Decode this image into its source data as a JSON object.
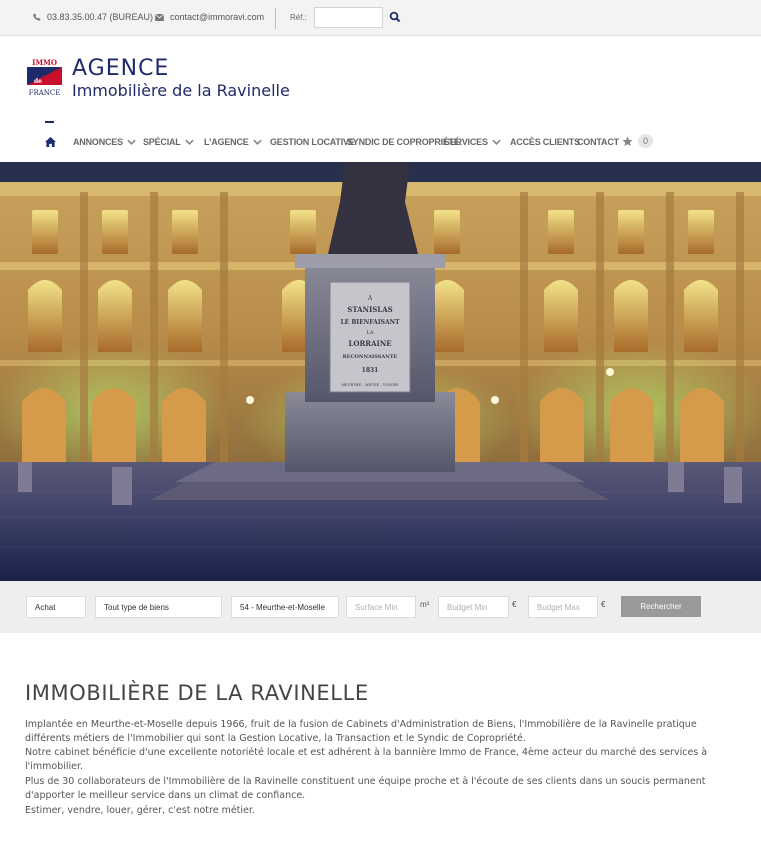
{
  "topbar": {
    "phone": "03.83.35.00.47 (BUREAU)",
    "email": "contact@immoravi.com",
    "ref_label": "Réf.:",
    "ref_value": ""
  },
  "brand": {
    "logo_lines": [
      "IMMO",
      "de",
      "FRANCE"
    ],
    "line1": "AGENCE",
    "line2": "Immobilière de la Ravinelle",
    "colors": {
      "navy": "#1f2a6b",
      "red": "#c8102e"
    }
  },
  "nav": {
    "items": [
      {
        "label": "ANNONCES",
        "dropdown": true
      },
      {
        "label": "SPÉCIAL",
        "dropdown": true
      },
      {
        "label": "L'AGENCE",
        "dropdown": true
      },
      {
        "label": "GESTION LOCATIVE",
        "dropdown": false
      },
      {
        "label": "SYNDIC DE COPROPRIÉTÉ",
        "dropdown": false
      },
      {
        "label": "SERVICES",
        "dropdown": true
      },
      {
        "label": "ACCÈS CLIENTS",
        "dropdown": false
      },
      {
        "label": "CONTACT",
        "dropdown": false
      }
    ],
    "favorites_count": "0"
  },
  "hero": {
    "plaque_lines": [
      "A",
      "STANISLAS",
      "LE BIENFAISANT",
      "LA",
      "LORRAINE",
      "RECONNAISSANTE",
      "1831",
      "MEURTHE – MEUSE – VOSGES"
    ]
  },
  "search": {
    "transaction": "Achat",
    "type": "Tout type de biens",
    "location": "54 - Meurthe-et-Moselle",
    "surface_placeholder": "Surface Min",
    "surface_unit": "m²",
    "budget_min_placeholder": "Budget Min",
    "budget_max_placeholder": "Budget Max",
    "currency": "€",
    "submit_label": "Rechercher"
  },
  "content": {
    "title": "IMMOBILIÈRE DE LA RAVINELLE",
    "paragraphs": [
      "Implantée en Meurthe-et-Moselle depuis 1966, fruit de la fusion de Cabinets d'Administration de Biens, l'Immobilière de la Ravinelle pratique différents métiers de l'Immobilier qui sont la Gestion Locative, la Transaction et le Syndic de Copropriété.",
      "Notre cabinet bénéficie d'une excellente notoriété locale et est adhérent à la bannière Immo de France, 4ème acteur du marché des services à l'immobilier.",
      "Plus de 30 collaborateurs de l'Immobilière de la Ravinelle constituent une équipe proche et à l'écoute de ses clients dans un soucis permanent d'apporter le meilleur service dans un climat de confiance.",
      "Estimer, vendre, louer, gérer, c'est notre métier."
    ]
  }
}
